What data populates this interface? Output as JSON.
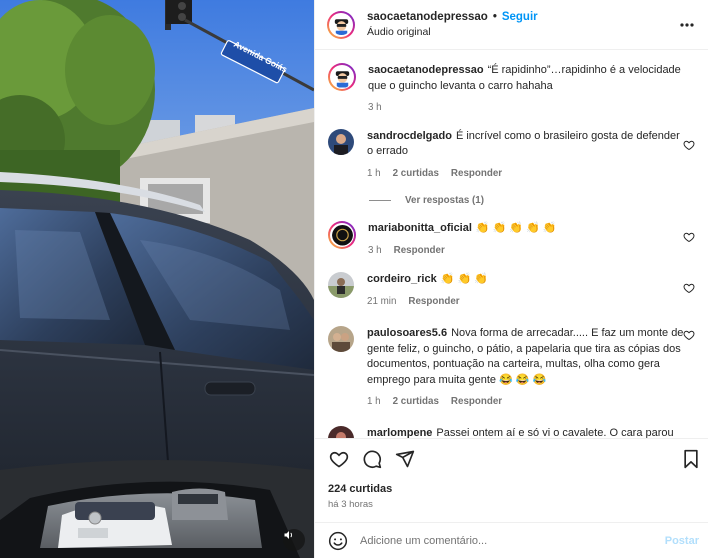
{
  "post": {
    "username": "saocaetanodepressao",
    "follow_label": "Seguir",
    "separator": "•",
    "audio_label": "Áudio original"
  },
  "video": {
    "street_sign_text": "Avenida Goiás"
  },
  "comments": [
    {
      "username": "saocaetanodepressao",
      "text": "“É rapidinho”…rapidinho é a velocidade que o guincho levanta o carro hahaha",
      "time": "3 h"
    },
    {
      "username": "sandrocdelgado",
      "text": "É incrível como o brasileiro gosta de defender o errado",
      "time": "1 h",
      "likes": "2 curtidas",
      "reply": "Responder",
      "view_replies": "Ver respostas (1)"
    },
    {
      "username": "mariabonitta_oficial",
      "text": "👏 👏 👏 👏 👏",
      "time": "3 h",
      "reply": "Responder"
    },
    {
      "username": "cordeiro_rick",
      "text": "👏 👏 👏",
      "time": "21 min",
      "reply": "Responder"
    },
    {
      "username": "paulosoares5.6",
      "text": "Nova forma de arrecadar..... E faz um monte de gente feliz, o guincho, o pátio, a papelaria que tira as cópias dos documentos, pontuação na carteira, multas, olha como gera emprego para muita gente 😂 😂 😂",
      "time": "1 h",
      "likes": "2 curtidas",
      "reply": "Responder"
    },
    {
      "username": "marlompene",
      "text": "Passei ontem aí e só vi o cavalete. O cara parou"
    }
  ],
  "footer": {
    "likes": "224 curtidas",
    "time_ago": "há 3 horas",
    "comment_placeholder": "Adicione um comentário...",
    "post_label": "Postar"
  },
  "colors": {
    "accent": "#0095f6",
    "muted": "#737373",
    "post_disabled": "#b2dffc"
  }
}
